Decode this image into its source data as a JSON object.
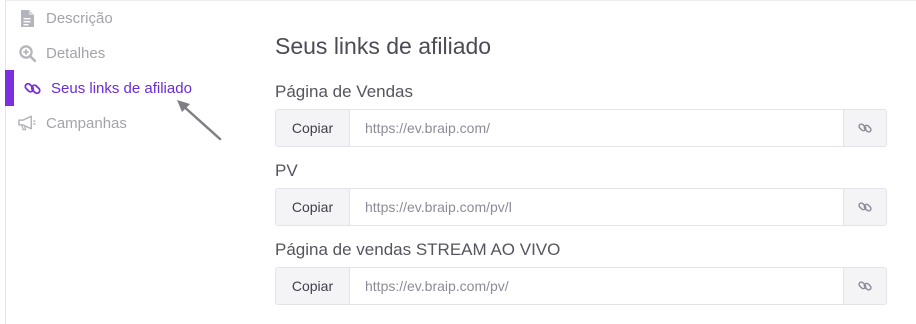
{
  "sidebar": {
    "items": [
      {
        "label": "Descrição",
        "icon": "document-icon",
        "active": false
      },
      {
        "label": "Detalhes",
        "icon": "zoom-in-icon",
        "active": false
      },
      {
        "label": "Seus links de afiliado",
        "icon": "link-icon",
        "active": true
      },
      {
        "label": "Campanhas",
        "icon": "megaphone-icon",
        "active": false
      }
    ],
    "active_color": "#7b2fe0",
    "inactive_color": "#a3a3ab"
  },
  "main": {
    "title": "Seus links de afiliado",
    "links": [
      {
        "label": "Página de Vendas",
        "copy_label": "Copiar",
        "url": "https://ev.braip.com/"
      },
      {
        "label": "PV",
        "copy_label": "Copiar",
        "url": "https://ev.braip.com/pv/l"
      },
      {
        "label": "Página de vendas STREAM AO VIVO",
        "copy_label": "Copiar",
        "url": "https://ev.braip.com/pv/"
      }
    ]
  }
}
